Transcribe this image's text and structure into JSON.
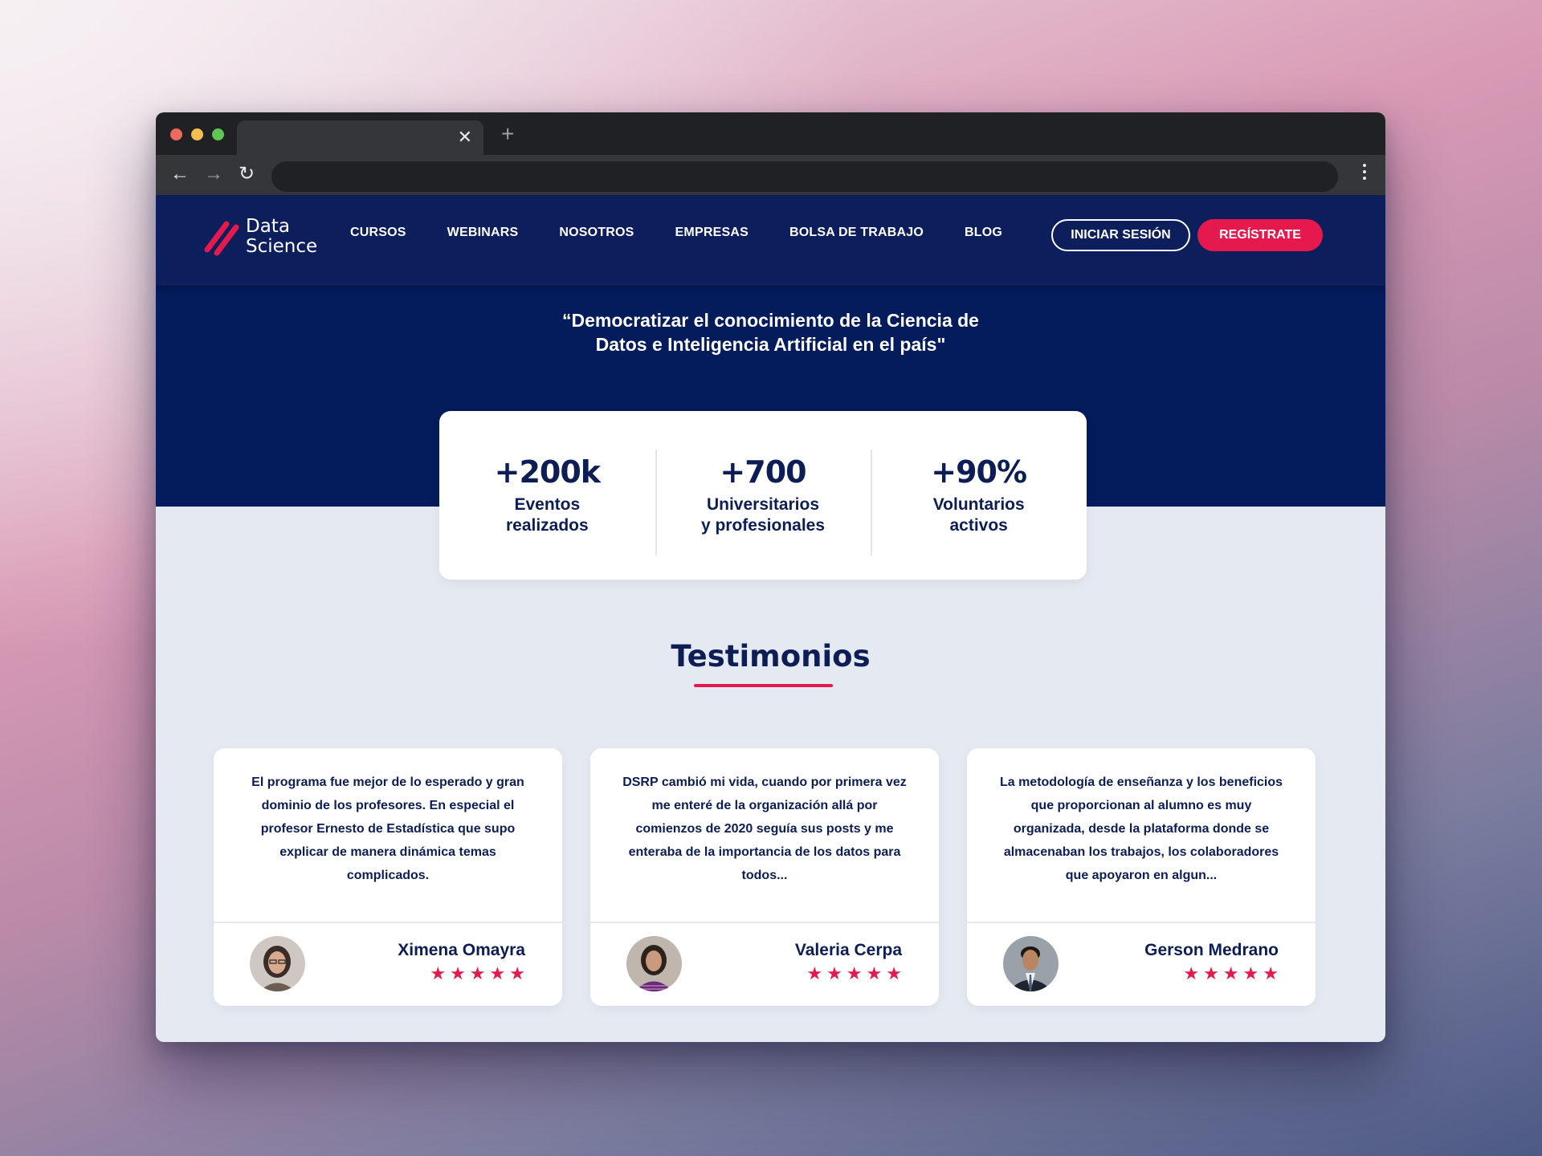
{
  "browser": {
    "tab_close": "✕",
    "new_tab": "+",
    "back": "←",
    "forward": "→",
    "reload": "↻"
  },
  "header": {
    "logo_line1": "Data",
    "logo_line2": "Science",
    "nav": [
      "CURSOS",
      "WEBINARS",
      "NOSOTROS",
      "EMPRESAS",
      "BOLSA DE TRABAJO",
      "BLOG"
    ],
    "login_label": "INICIAR SESIÓN",
    "register_label": "REGÍSTRATE"
  },
  "hero": {
    "quote_line1": "“Democratizar el conocimiento de la Ciencia de",
    "quote_line2": "Datos e Inteligencia Artificial en el país\""
  },
  "stats": [
    {
      "value": "+200k",
      "label_line1": "Eventos",
      "label_line2": "realizados"
    },
    {
      "value": "+700",
      "label_line1": "Universitarios",
      "label_line2": "y profesionales"
    },
    {
      "value": "+90%",
      "label_line1": "Voluntarios",
      "label_line2": "activos"
    }
  ],
  "testimonials": {
    "title": "Testimonios",
    "items": [
      {
        "text": "El programa fue mejor de lo esperado y gran dominio de los profesores. En especial el profesor Ernesto de Estadística que supo explicar de manera dinámica temas complicados.",
        "name": "Ximena Omayra",
        "rating": 5
      },
      {
        "text": "DSRP cambió mi vida, cuando por primera vez me enteré de la organización allá por comienzos de 2020 seguía sus posts y me enteraba de la importancia de los datos para todos...",
        "name": "Valeria Cerpa",
        "rating": 5
      },
      {
        "text": "La metodología de enseñanza y los beneficios que proporcionan al alumno es muy organizada, desde la plataforma donde se almacenaban los trabajos, los colaboradores que apoyaron en algun...",
        "name": "Gerson Medrano",
        "rating": 5
      }
    ]
  },
  "colors": {
    "navy": "#041c5c",
    "accent": "#e5194e",
    "page_bg": "#e4e9f2"
  }
}
